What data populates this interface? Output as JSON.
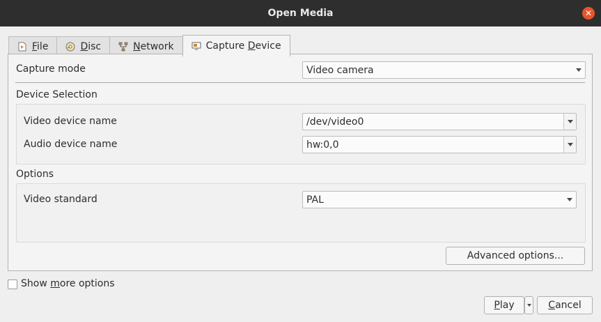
{
  "window": {
    "title": "Open Media"
  },
  "tabs": [
    {
      "pre": "",
      "mnemonic": "F",
      "post": "ile",
      "icon": "file-icon"
    },
    {
      "pre": "",
      "mnemonic": "D",
      "post": "isc",
      "icon": "disc-icon"
    },
    {
      "pre": "",
      "mnemonic": "N",
      "post": "etwork",
      "icon": "network-icon"
    },
    {
      "pre": "Capture ",
      "mnemonic": "D",
      "post": "evice",
      "icon": "capture-device-icon"
    }
  ],
  "capture": {
    "mode_label": "Capture mode",
    "mode_value": "Video camera",
    "device_selection_heading": "Device Selection",
    "video_device_label": "Video device name",
    "video_device_value": "/dev/video0",
    "audio_device_label": "Audio device name",
    "audio_device_value": "hw:0,0",
    "options_heading": "Options",
    "video_standard_label": "Video standard",
    "video_standard_value": "PAL",
    "advanced_button": "Advanced options..."
  },
  "footer": {
    "show_more_pre": "Show ",
    "show_more_mnemonic": "m",
    "show_more_post": "ore options",
    "play_mnemonic": "P",
    "play_rest": "lay",
    "cancel_mnemonic": "C",
    "cancel_rest": "ancel"
  }
}
